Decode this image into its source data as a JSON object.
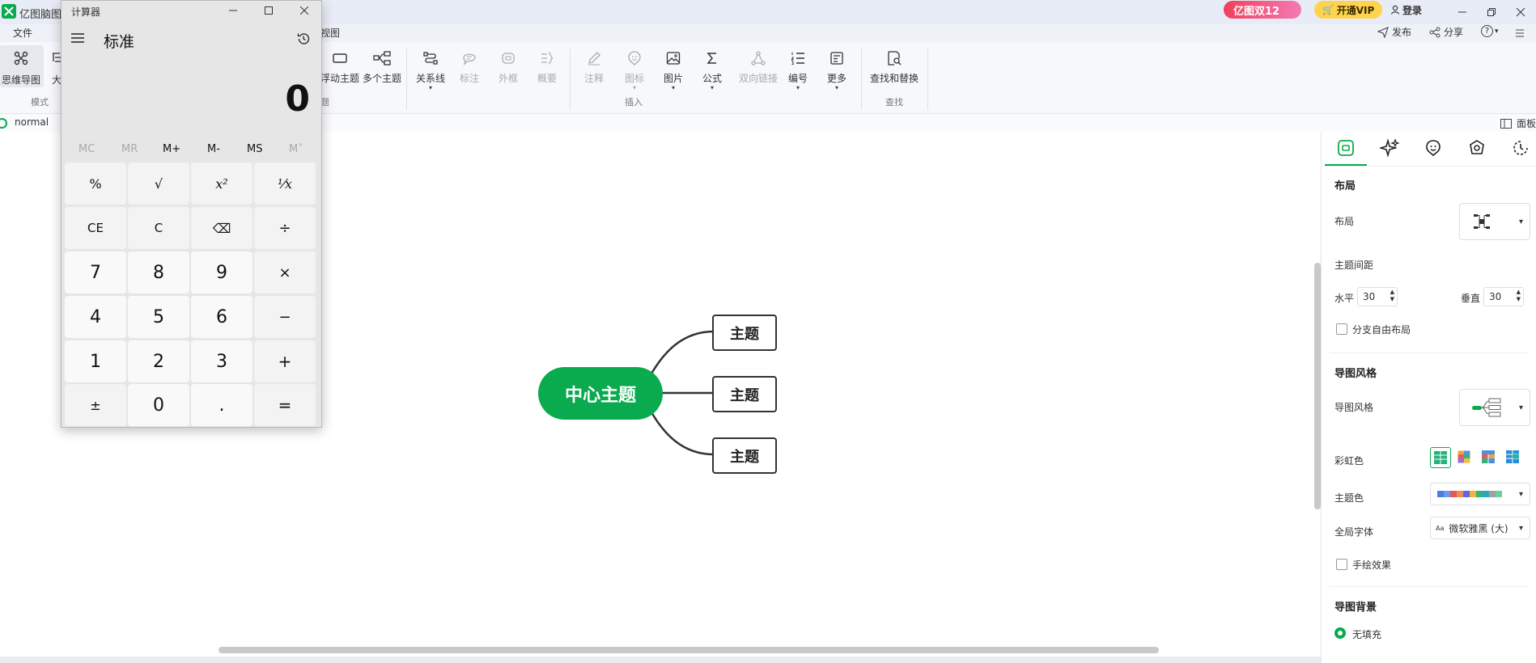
{
  "app": {
    "title": "亿图脑图MindMaster",
    "promo_badge": "亿图双12",
    "vip_button": "开通VIP",
    "login_button": "登录",
    "publish": "发布",
    "share": "分享",
    "help": "?"
  },
  "menu": {
    "file": "文件",
    "view": "视图"
  },
  "ribbon": {
    "mode_btn": "思维导图",
    "outline_btn": "大",
    "group_mode": "模式",
    "float_topic": "浮动主题",
    "multi_topic": "多个主题",
    "group_topic": "题",
    "relation": "关系线",
    "callout": "标注",
    "boundary": "外框",
    "summary": "概要",
    "note": "注释",
    "icon": "图标",
    "picture": "图片",
    "formula": "公式",
    "bilink": "双向链接",
    "numbering": "编号",
    "more": "更多",
    "group_insert": "插入",
    "find_replace": "查找和替换",
    "group_find": "查找"
  },
  "tabsrow": {
    "doc": "normal",
    "panel": "面板"
  },
  "mindmap": {
    "center": "中心主题",
    "topics": [
      "主题",
      "主题",
      "主题"
    ],
    "center_color": "#0aaa4f"
  },
  "panel": {
    "layout_section": "布局",
    "layout_label": "布局",
    "spacing_label": "主题间距",
    "horizontal_label": "水平",
    "horizontal_value": "30",
    "vertical_label": "垂直",
    "vertical_value": "30",
    "free_layout": "分支自由布局",
    "style_section": "导图风格",
    "style_label": "导图风格",
    "rainbow_label": "彩虹色",
    "theme_color_label": "主题色",
    "font_label": "全局字体",
    "font_value": "微软雅黑 (大)",
    "font_prefix": "Aa",
    "hand_drawn": "手绘效果",
    "bg_section": "导图背景",
    "no_fill": "无填充",
    "accent": "#0aaa4f"
  },
  "calculator": {
    "title": "计算器",
    "mode": "标准",
    "display": "0",
    "memory": [
      "MC",
      "MR",
      "M+",
      "M-",
      "MS",
      "M˅"
    ],
    "keys": [
      [
        "%",
        "√",
        "x²",
        "¹⁄x"
      ],
      [
        "CE",
        "C",
        "⌫",
        "÷"
      ],
      [
        "7",
        "8",
        "9",
        "×"
      ],
      [
        "4",
        "5",
        "6",
        "−"
      ],
      [
        "1",
        "2",
        "3",
        "+"
      ],
      [
        "±",
        "0",
        ".",
        "="
      ]
    ]
  }
}
